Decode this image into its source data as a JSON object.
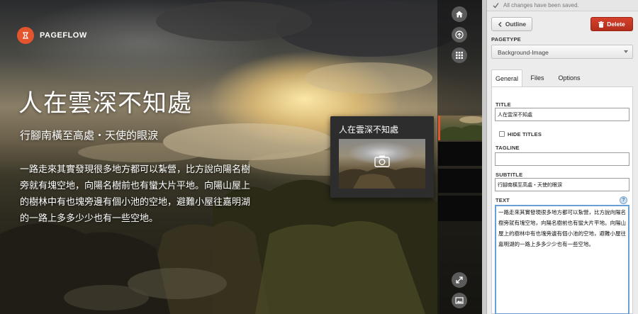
{
  "app": {
    "name": "PAGEFLOW"
  },
  "page": {
    "title": "人在雲深不知處",
    "tagline": "行腳南橫至高處・天使的眼淚",
    "text": "一路走來其實發現很多地方都可以紮營，比方說向陽名樹旁就有塊空地，向陽名樹前也有蠻大片平地。向陽山屋上的樹林中有也塊旁邊有個小池的空地，避難小屋往嘉明湖的一路上多多少少也有一些空地。"
  },
  "overlay": {
    "title": "人在雲深不知處"
  },
  "nav_icons": {
    "home": "home-icon",
    "up": "arrow-up-icon",
    "grid": "grid-icon",
    "fullscreen": "expand-icon",
    "image": "image-icon"
  },
  "editor": {
    "saved_status": "All changes have been saved.",
    "outline_label": "Outline",
    "delete_label": "Delete",
    "pagetype_label": "PAGETYPE",
    "pagetype_value": "Background-Image",
    "tabs": [
      {
        "label": "General"
      },
      {
        "label": "Files"
      },
      {
        "label": "Options"
      }
    ],
    "fields": {
      "title_label": "TITLE",
      "title_value": "人在雲深不知處",
      "hide_titles_label": "HIDE TITLES",
      "tagline_label": "TAGLINE",
      "tagline_value": "",
      "subtitle_label": "SUBTITLE",
      "subtitle_value": "行腳南橫至高處・天使的眼淚",
      "text_label": "TEXT",
      "help_label": "?",
      "text_value": "一路走來其實發現很多地方都可以紮營，比方說向陽名樹旁就有塊空地，向陽名樹前也有蠻大片平地。向陽山屋上的樹林中有也塊旁邊有個小池的空地，避難小屋往嘉明湖的一路上多多少少也有一些空地。"
    }
  },
  "colors": {
    "accent": "#e4552e",
    "delete": "#c0392b",
    "focus": "#6a9fd6"
  }
}
